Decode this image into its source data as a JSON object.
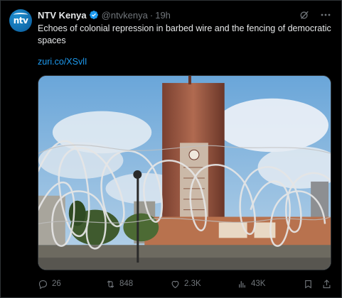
{
  "tweet": {
    "author_name": "NTV Kenya",
    "handle": "@ntvkenya",
    "separator": "·",
    "time": "19h",
    "avatar_text": "ntv",
    "text": "Echoes of colonial repression in barbed wire and the fencing of democratic spaces",
    "link": "zuri.co/XSvlI"
  },
  "actions": {
    "replies": "26",
    "reposts": "848",
    "likes": "2.3K",
    "views": "43K"
  },
  "colors": {
    "background": "#000000",
    "text": "#e7e9ea",
    "muted": "#71767b",
    "link": "#1d9bf0",
    "verified": "#1d9bf0"
  },
  "icons": [
    "verified-badge-icon",
    "grok-icon",
    "more-icon",
    "reply-icon",
    "repost-icon",
    "like-icon",
    "views-icon",
    "bookmark-icon",
    "share-icon"
  ]
}
